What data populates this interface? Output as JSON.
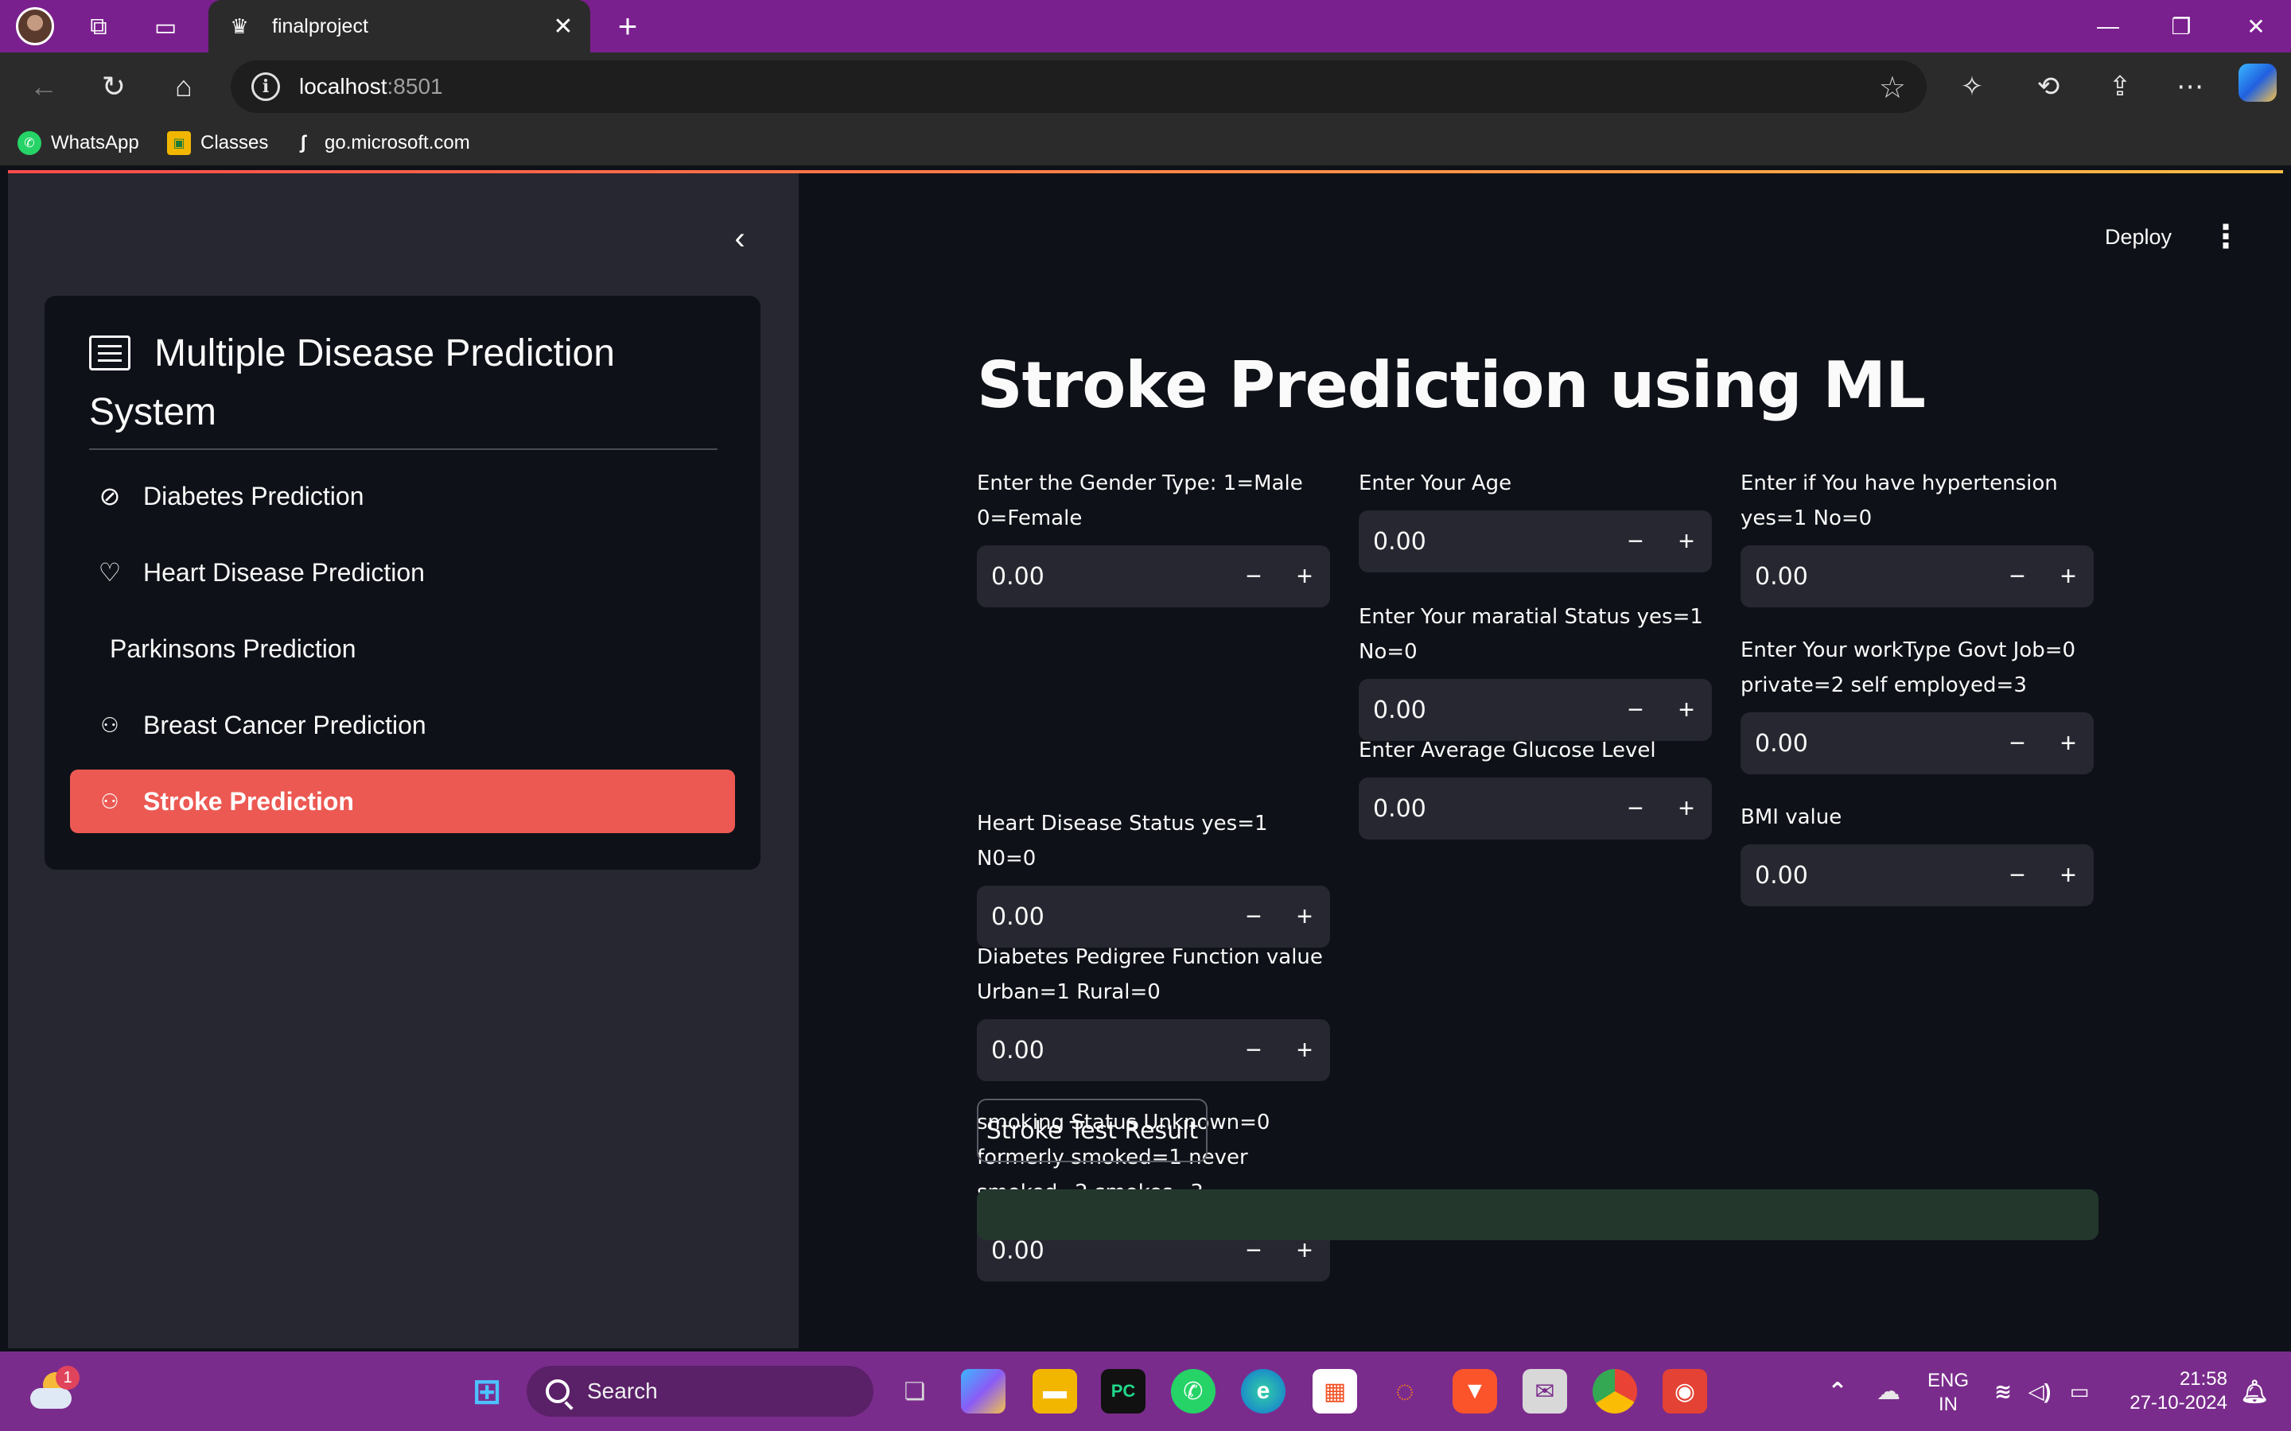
{
  "browser": {
    "tab_title": "finalproject",
    "address_host": "localhost",
    "address_port": ":8501",
    "bookmarks": [
      {
        "label": "WhatsApp"
      },
      {
        "label": "Classes"
      },
      {
        "label": "go.microsoft.com"
      }
    ]
  },
  "sidebar": {
    "menu_title": "Multiple Disease Prediction System",
    "items": [
      {
        "label": "Diabetes Prediction",
        "icon": "bandaid-icon"
      },
      {
        "label": "Heart Disease Prediction",
        "icon": "heart-icon"
      },
      {
        "label": "Parkinsons Prediction",
        "icon": ""
      },
      {
        "label": "Breast Cancer Prediction",
        "icon": "person-icon"
      },
      {
        "label": "Stroke Prediction",
        "icon": "person-icon",
        "active": true
      }
    ]
  },
  "header": {
    "deploy_label": "Deploy"
  },
  "main": {
    "title": "Stroke Prediction using ML",
    "fields": {
      "gender": {
        "label": "Enter the Gender Type: 1=Male 0=Female",
        "value": "0.00"
      },
      "age": {
        "label": "Enter Your Age",
        "value": "0.00"
      },
      "hypertension": {
        "label": "Enter if You have hypertension yes=1 No=0",
        "value": "0.00"
      },
      "marital": {
        "label": "Enter Your maratial Status yes=1 No=0",
        "value": "0.00"
      },
      "heart_disease": {
        "label": "Heart Disease Status yes=1 N0=0",
        "value": "0.00"
      },
      "work_type": {
        "label": "Enter Your workType Govt Job=0 private=2 self employed=3",
        "value": "0.00"
      },
      "glucose": {
        "label": "Enter Average Glucose Level",
        "value": "0.00"
      },
      "pedigree": {
        "label": "Diabetes Pedigree Function value Urban=1 Rural=0",
        "value": "0.00"
      },
      "bmi": {
        "label": "BMI value",
        "value": "0.00"
      },
      "smoking": {
        "label": "smoking Status Unknown=0 formerly smoked=1 never smoked=2 smokes=3",
        "value": "0.00"
      }
    },
    "step_minus": "−",
    "step_plus": "+",
    "submit_label": "Stroke Test Result",
    "result_text": ""
  },
  "taskbar": {
    "search_label": "Search",
    "weather_badge": "1",
    "lang_line1": "ENG",
    "lang_line2": "IN",
    "time": "21:58",
    "date": "27-10-2024"
  },
  "colors": {
    "accent": "#ec5953",
    "titlebar": "#7a1f8e",
    "sidebar_bg": "#262730",
    "main_bg": "#0e1117",
    "result_bg": "#23372d"
  }
}
